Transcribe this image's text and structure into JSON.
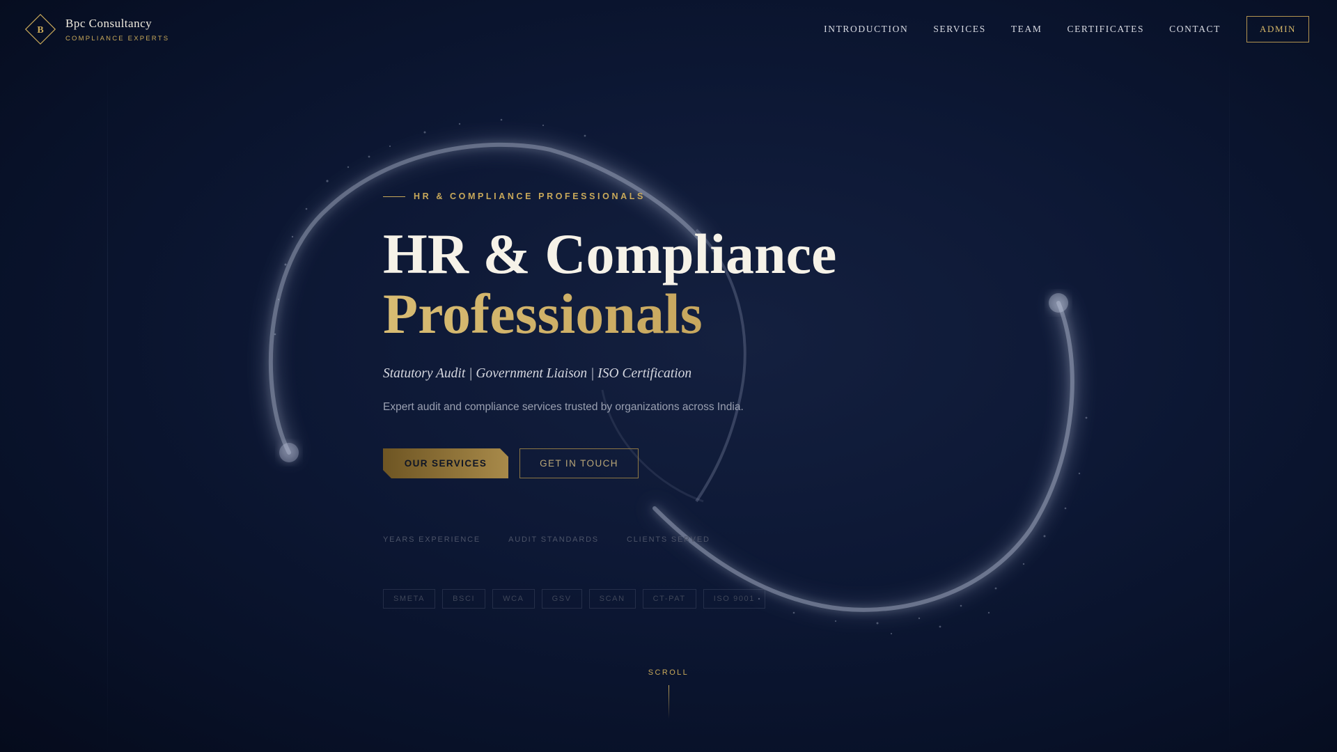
{
  "brand": {
    "logo_letter": "B",
    "name": "Bpc Consultancy",
    "tagline": "COMPLIANCE EXPERTS",
    "accent_color": "#c9a95a"
  },
  "nav": {
    "items": [
      {
        "label": "INTRODUCTION"
      },
      {
        "label": "SERVICES"
      },
      {
        "label": "TEAM"
      },
      {
        "label": "CERTIFICATES"
      },
      {
        "label": "CONTACT"
      }
    ],
    "admin_label": "ADMIN"
  },
  "hero": {
    "eyebrow": "HR & COMPLIANCE PROFESSIONALS",
    "title_line1": "HR & Compliance",
    "title_line2": "Professionals",
    "subtitle": "Statutory Audit | Government Liaison | ISO Certification",
    "description": "Expert audit and compliance services trusted by organizations across India.",
    "primary_cta": "OUR SERVICES",
    "secondary_cta": "GET IN TOUCH"
  },
  "stats": [
    {
      "label": "YEARS EXPERIENCE"
    },
    {
      "label": "AUDIT STANDARDS"
    },
    {
      "label": "CLIENTS SERVED"
    }
  ],
  "badges": [
    "SMETA",
    "BSCI",
    "WCA",
    "GSV",
    "SCAN",
    "CT-PAT",
    "ISO 9001"
  ],
  "scroll": {
    "label": "SCROLL"
  },
  "colors": {
    "background": "#081128",
    "gold": "#c9a95a",
    "text_light": "#f6f2e8"
  }
}
